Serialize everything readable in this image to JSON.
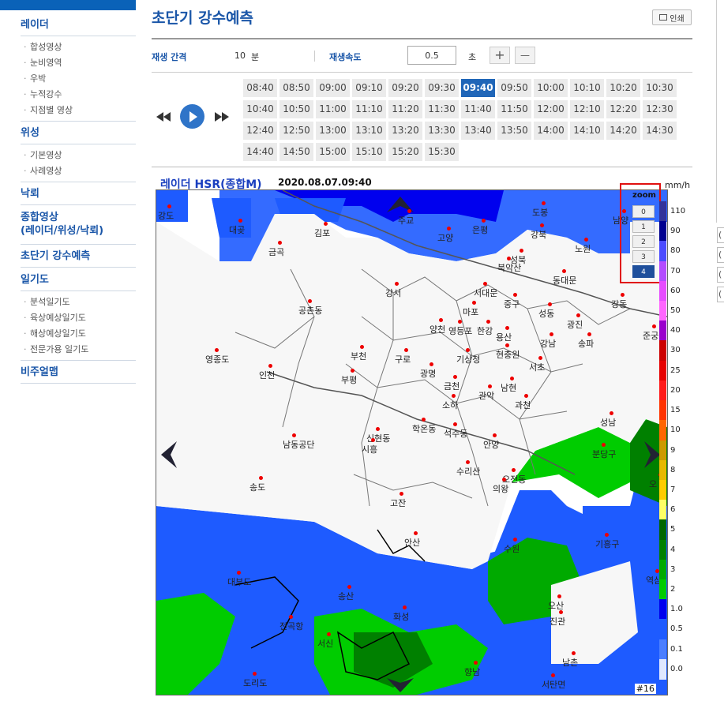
{
  "sidebar": {
    "groups": [
      {
        "label": "레이더",
        "items": [
          "합성영상",
          "눈비영역",
          "우박",
          "누적강수",
          "지점별 영상"
        ]
      },
      {
        "label": "위성",
        "items": [
          "기본영상",
          "사례영상"
        ]
      },
      {
        "label": "낙뢰",
        "items": []
      },
      {
        "label": "종합영상\n(레이더/위성/낙뢰)",
        "items": []
      },
      {
        "label": "초단기 강수예측",
        "items": []
      },
      {
        "label": "일기도",
        "items": [
          "분석일기도",
          "육상예상일기도",
          "해상예상일기도",
          "전문가용 일기도"
        ]
      },
      {
        "label": "비주얼맵",
        "items": []
      }
    ],
    "group_line1": "종합영상",
    "group_line2": "(레이더/위성/낙뢰)"
  },
  "header": {
    "title": "초단기 강수예측",
    "print_label": "인쇄"
  },
  "controls": {
    "interval_label": "재생 간격",
    "interval_value": "10",
    "interval_unit": "분",
    "speed_label": "재생속도",
    "speed_value": "0.5",
    "speed_unit": "초",
    "plus": "+",
    "minus": "—"
  },
  "times": [
    "08:40",
    "08:50",
    "09:00",
    "09:10",
    "09:20",
    "09:30",
    "09:40",
    "09:50",
    "10:00",
    "10:10",
    "10:20",
    "10:30",
    "10:40",
    "10:50",
    "11:00",
    "11:10",
    "11:20",
    "11:30",
    "11:40",
    "11:50",
    "12:00",
    "12:10",
    "12:20",
    "12:30",
    "12:40",
    "12:50",
    "13:00",
    "13:10",
    "13:20",
    "13:30",
    "13:40",
    "13:50",
    "14:00",
    "14:10",
    "14:20",
    "14:30",
    "14:40",
    "14:50",
    "15:00",
    "15:10",
    "15:20",
    "15:30"
  ],
  "active_time": "09:40",
  "map": {
    "title": "레이더 HSR(종합M)",
    "timestamp": "2020.08.07.09:40",
    "unit": "mm/h",
    "frame": "#16",
    "zoom_label": "zoom",
    "zoom_levels": [
      "0",
      "1",
      "2",
      "3",
      "4"
    ],
    "zoom_selected": "4",
    "places": [
      "강도",
      "대곶",
      "김포",
      "주교",
      "고양",
      "은평",
      "도봉",
      "강북",
      "노원",
      "남양",
      "금곡",
      "성북",
      "북악산",
      "동대문",
      "서대문",
      "강서",
      "마포",
      "중구",
      "성동",
      "광진",
      "강동",
      "공촌동",
      "양천",
      "영등포",
      "한강",
      "용산",
      "강남",
      "송파",
      "준궁",
      "영종도",
      "부천",
      "구로",
      "기상청",
      "현충원",
      "서초",
      "인천",
      "광명",
      "부평",
      "금천",
      "관악",
      "남현",
      "과천",
      "소하",
      "학온동",
      "석수동",
      "성남",
      "남동공단",
      "신현동",
      "시흥",
      "안양",
      "분당구",
      "송도",
      "수리산",
      "오전동",
      "의왕",
      "고잔",
      "안산",
      "수원",
      "기흥구",
      "대부도",
      "송산",
      "오산",
      "화성",
      "진관",
      "전곡항",
      "서신",
      "남촌",
      "향남",
      "도리도",
      "서탄면",
      "역삼",
      "오"
    ],
    "legend_labels": [
      "110",
      "90",
      "80",
      "70",
      "60",
      "50",
      "40",
      "30",
      "25",
      "20",
      "15",
      "10",
      "9",
      "8",
      "7",
      "6",
      "5",
      "4",
      "3",
      "2",
      "1.0",
      "0.5",
      "0.1",
      "0.0"
    ],
    "legend_colors": [
      "#333399",
      "#000090",
      "#4c4cff",
      "#b34cff",
      "#e64cff",
      "#ff66ff",
      "#9900cc",
      "#cc0000",
      "#e60000",
      "#ff1a1a",
      "#ff3300",
      "#ff6600",
      "#cc9900",
      "#e6b800",
      "#ffcc00",
      "#ffff66",
      "#006600",
      "#008000",
      "#00aa00",
      "#00cc00",
      "#0000ee",
      "#1e5bff",
      "#4c7fff",
      "#e0e8ff"
    ]
  },
  "right_tabs": [
    "(",
    "(",
    "(",
    "("
  ]
}
